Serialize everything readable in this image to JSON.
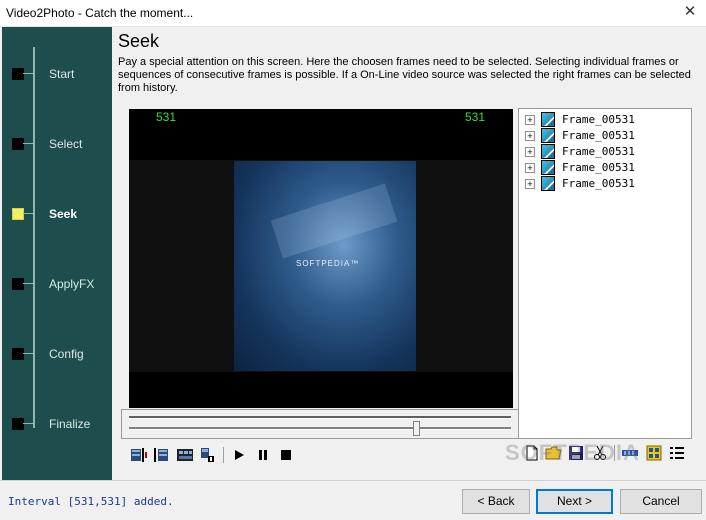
{
  "window": {
    "title": "Video2Photo - Catch the moment..."
  },
  "sidebar": {
    "steps": [
      {
        "label": "Start",
        "active": false
      },
      {
        "label": "Select",
        "active": false
      },
      {
        "label": "Seek",
        "active": true
      },
      {
        "label": "ApplyFX",
        "active": false
      },
      {
        "label": "Config",
        "active": false
      },
      {
        "label": "Finalize",
        "active": false
      }
    ]
  },
  "main": {
    "heading": "Seek",
    "description": "Pay a special attention on this screen. Here the choosen frames need to be selected. Selecting individual frames or sequences of consecutive frames is possible. If a On-Line video source was selected the right frames can be selected from history.",
    "video": {
      "frame_left": "531",
      "frame_right": "531",
      "overlay_text": "SOFTPEDIA™",
      "seek_position": 0.75
    },
    "frames": [
      {
        "label": "Frame_00531"
      },
      {
        "label": "Frame_00531"
      },
      {
        "label": "Frame_00531"
      },
      {
        "label": "Frame_00531"
      },
      {
        "label": "Frame_00531"
      }
    ]
  },
  "status": {
    "text": "Interval [531,531] added."
  },
  "buttons": {
    "back": "< Back",
    "next": "Next >",
    "cancel": "Cancel"
  },
  "watermark": "SOFTPEDIA",
  "colors": {
    "sidebar_bg": "#1e4d4d",
    "active_step": "#f1f060",
    "frame_number": "#3cdc3c",
    "status_text": "#1a3a8a"
  }
}
